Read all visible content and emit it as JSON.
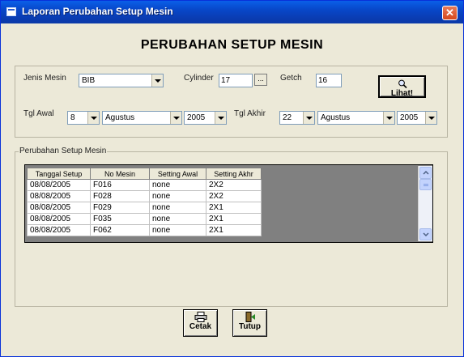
{
  "window": {
    "title": "Laporan Perubahan Setup Mesin",
    "close": "✕"
  },
  "heading": "PERUBAHAN SETUP MESIN",
  "filter": {
    "jenis_label": "Jenis Mesin",
    "jenis_value": "BIB",
    "cylinder_label": "Cylinder",
    "cylinder_value": "17",
    "browse_label": "...",
    "getch_label": "Getch",
    "getch_value": "16",
    "lihat_label": "Lihat!",
    "tgl_awal_label": "Tgl Awal",
    "awal_day": "8",
    "awal_month": "Agustus",
    "awal_year": "2005",
    "tgl_akhir_label": "Tgl Akhir",
    "akhir_day": "22",
    "akhir_month": "Agustus",
    "akhir_year": "2005"
  },
  "result": {
    "legend": "Perubahan Setup Mesin",
    "columns": [
      "Tanggal Setup",
      "No Mesin",
      "Setting Awal",
      "Setting Akhr"
    ],
    "rows": [
      [
        "08/08/2005",
        "F016",
        "none",
        "2X2"
      ],
      [
        "08/08/2005",
        "F028",
        "none",
        "2X2"
      ],
      [
        "08/08/2005",
        "F029",
        "none",
        "2X1"
      ],
      [
        "08/08/2005",
        "F035",
        "none",
        "2X1"
      ],
      [
        "08/08/2005",
        "F062",
        "none",
        "2X1"
      ]
    ]
  },
  "buttons": {
    "cetak": "Cetak",
    "tutup": "Tutup"
  },
  "icons": {
    "app": "window-icon",
    "lihat": "magnifier-icon",
    "cetak": "printer-icon",
    "tutup": "exit-door-icon"
  }
}
